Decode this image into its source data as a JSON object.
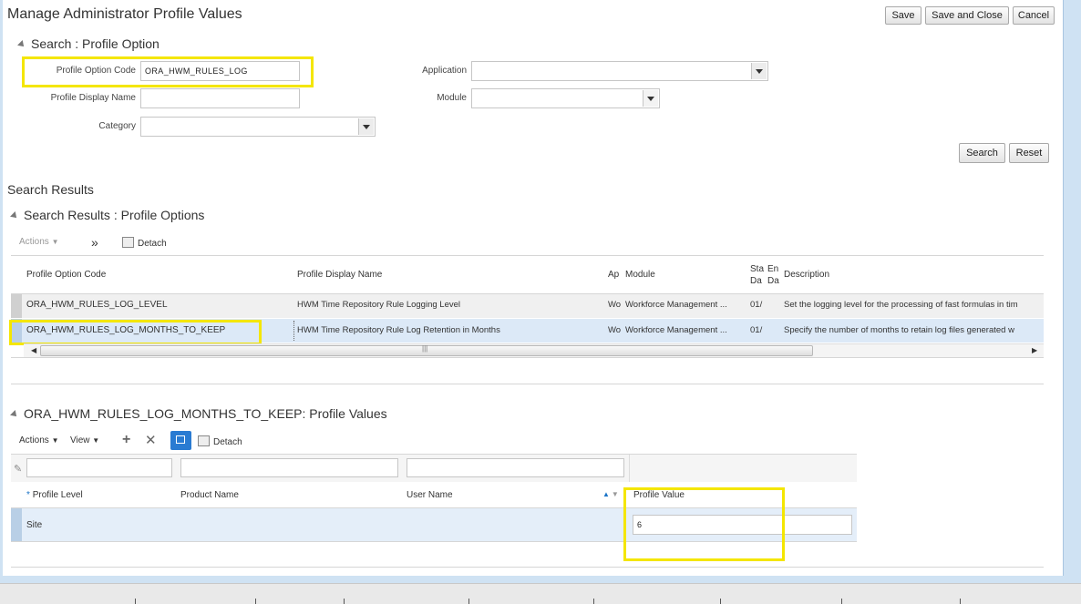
{
  "page": {
    "title": "Manage Administrator Profile Values"
  },
  "actions": {
    "save": "Save",
    "save_close": "Save and Close",
    "cancel": "Cancel"
  },
  "search": {
    "section_title": "Search : Profile Option",
    "fields": {
      "profile_option_code": {
        "label": "Profile Option Code",
        "value": "ORA_HWM_RULES_LOG"
      },
      "profile_display_name": {
        "label": "Profile Display Name",
        "value": ""
      },
      "category": {
        "label": "Category",
        "value": ""
      },
      "application": {
        "label": "Application",
        "value": ""
      },
      "module": {
        "label": "Module",
        "value": ""
      }
    },
    "search_button": "Search",
    "reset_button": "Reset"
  },
  "results": {
    "heading": "Search Results",
    "section_title": "Search Results : Profile Options",
    "toolbar": {
      "actions": "Actions",
      "more": "»",
      "detach": "Detach"
    },
    "columns": [
      "Profile Option Code",
      "Profile Display Name",
      "Application",
      "Module",
      "Start Date",
      "End Date",
      "Description"
    ],
    "column_display": {
      "application": "Ap",
      "start_date": [
        "Sta",
        "Da"
      ],
      "end_date": [
        "En",
        "Da"
      ]
    },
    "rows": [
      {
        "code": "ORA_HWM_RULES_LOG_LEVEL",
        "display_name": "HWM Time Repository Rule Logging Level",
        "app": "Wo",
        "module": "Workforce Management ...",
        "start": "01/",
        "description": "Set the logging level for the processing of fast formulas in tim"
      },
      {
        "code": "ORA_HWM_RULES_LOG_MONTHS_TO_KEEP",
        "display_name": "HWM Time Repository Rule Log Retention in Months",
        "app": "Wo",
        "module": "Workforce Management ...",
        "start": "01/",
        "description": "Specify the number of months to retain log files generated w"
      }
    ]
  },
  "values": {
    "section_title": "ORA_HWM_RULES_LOG_MONTHS_TO_KEEP: Profile Values",
    "toolbar": {
      "actions": "Actions",
      "view": "View",
      "detach": "Detach"
    },
    "columns": {
      "profile_level": "Profile Level",
      "product_name": "Product Name",
      "user_name": "User Name",
      "profile_value": "Profile Value",
      "required_mark": "*"
    },
    "rows": [
      {
        "profile_level": "Site",
        "profile_value": "6"
      }
    ]
  }
}
